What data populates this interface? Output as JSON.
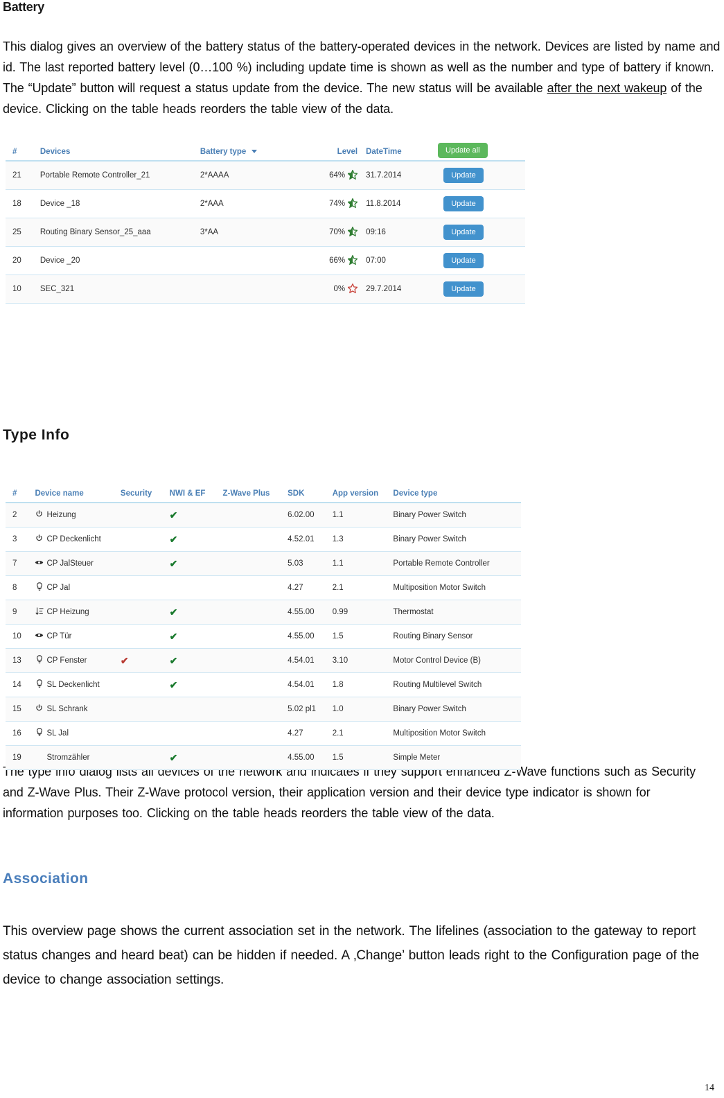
{
  "document": {
    "page_number": "14"
  },
  "sections": {
    "battery": {
      "heading": "Battery",
      "paragraph_html": "This dialog gives an overview of the battery status of the battery-operated devices in the network. Devices are listed by name and id. The last reported battery level (0…100 %) including update time is shown as well as the number and type of battery if known. The “Update” button will request a status update from the device. The new status will be available <span class=\"u\">after the next wakeup</span> of the device. Clicking on the table heads reorders the table view of the data."
    },
    "type_info": {
      "heading": "Type Info",
      "paragraph": "The type info dialog lists all devices of the network and indicates if they support enhanced Z-Wave functions such as Security and Z-Wave Plus. Their Z-Wave protocol version, their application version and their device type indicator is shown for information purposes too. Clicking on the table heads reorders the table view of the data."
    },
    "association": {
      "heading": "Association",
      "paragraph": "This overview page shows the current association set in the network. The lifelines (association to the gateway to report status changes and heard beat) can be hidden if needed. A ‚Change’ button leads right to the Configuration page of the device to change association settings."
    }
  },
  "battery_table": {
    "update_all_label": "Update all",
    "row_button_label": "Update",
    "columns": [
      "#",
      "Devices",
      "Battery type",
      "Level",
      "DateTime",
      ""
    ],
    "sort_indicator_column": "Battery type",
    "colors": {
      "header_text": "#4a7fb5",
      "primary_button": "#4292cd",
      "success_button": "#5cb85c",
      "star_filled": "#2f7d32",
      "star_empty": "#c9453d"
    },
    "rows": [
      {
        "id": "21",
        "device": "Portable Remote Controller_21",
        "battery_type": "2*AAAA",
        "level": "64%",
        "star": "half-green",
        "datetime": "31.7.2014"
      },
      {
        "id": "18",
        "device": "Device _18",
        "battery_type": "2*AAA",
        "level": "74%",
        "star": "half-green",
        "datetime": "11.8.2014"
      },
      {
        "id": "25",
        "device": "Routing Binary Sensor_25_aaa",
        "battery_type": "3*AA",
        "level": "70%",
        "star": "half-green",
        "datetime": "09:16"
      },
      {
        "id": "20",
        "device": "Device _20",
        "battery_type": "",
        "level": "66%",
        "star": "half-green",
        "datetime": "07:00"
      },
      {
        "id": "10",
        "device": "SEC_321",
        "battery_type": "",
        "level": "0%",
        "star": "empty-red",
        "datetime": "29.7.2014"
      }
    ]
  },
  "typeinfo_table": {
    "columns": [
      "#",
      "Device name",
      "Security",
      "NWI & EF",
      "Z-Wave Plus",
      "SDK",
      "App version",
      "Device type"
    ],
    "rows": [
      {
        "id": "2",
        "icon": "power-icon",
        "name": "Heizung",
        "security": "",
        "nwi_ef": "check",
        "zwave_plus": "",
        "sdk": "6.02.00",
        "app": "1.1",
        "device_type": "Binary Power Switch"
      },
      {
        "id": "3",
        "icon": "power-icon",
        "name": "CP Deckenlicht",
        "security": "",
        "nwi_ef": "check",
        "zwave_plus": "",
        "sdk": "4.52.01",
        "app": "1.3",
        "device_type": "Binary Power Switch"
      },
      {
        "id": "7",
        "icon": "eye-icon",
        "name": "CP JalSteuer",
        "security": "",
        "nwi_ef": "check",
        "zwave_plus": "",
        "sdk": "5.03",
        "app": "1.1",
        "device_type": "Portable Remote Controller"
      },
      {
        "id": "8",
        "icon": "bulb-icon",
        "name": "CP Jal",
        "security": "",
        "nwi_ef": "",
        "zwave_plus": "",
        "sdk": "4.27",
        "app": "2.1",
        "device_type": "Multiposition Motor Switch"
      },
      {
        "id": "9",
        "icon": "level-icon",
        "name": "CP Heizung",
        "security": "",
        "nwi_ef": "check",
        "zwave_plus": "",
        "sdk": "4.55.00",
        "app": "0.99",
        "device_type": "Thermostat"
      },
      {
        "id": "10",
        "icon": "eye-icon",
        "name": "CP Tür",
        "security": "",
        "nwi_ef": "check",
        "zwave_plus": "",
        "sdk": "4.55.00",
        "app": "1.5",
        "device_type": "Routing Binary Sensor"
      },
      {
        "id": "13",
        "icon": "bulb-icon",
        "name": "CP Fenster",
        "security": "check-red",
        "nwi_ef": "check",
        "zwave_plus": "",
        "sdk": "4.54.01",
        "app": "3.10",
        "device_type": "Motor Control Device (B)"
      },
      {
        "id": "14",
        "icon": "bulb-icon",
        "name": "SL Deckenlicht",
        "security": "",
        "nwi_ef": "check",
        "zwave_plus": "",
        "sdk": "4.54.01",
        "app": "1.8",
        "device_type": "Routing Multilevel Switch"
      },
      {
        "id": "15",
        "icon": "power-icon",
        "name": "SL Schrank",
        "security": "",
        "nwi_ef": "",
        "zwave_plus": "",
        "sdk": "5.02 pl1",
        "app": "1.0",
        "device_type": "Binary Power Switch"
      },
      {
        "id": "16",
        "icon": "bulb-icon",
        "name": "SL Jal",
        "security": "",
        "nwi_ef": "",
        "zwave_plus": "",
        "sdk": "4.27",
        "app": "2.1",
        "device_type": "Multiposition Motor Switch"
      },
      {
        "id": "19",
        "icon": "",
        "name": "Stromzähler",
        "security": "",
        "nwi_ef": "check",
        "zwave_plus": "",
        "sdk": "4.55.00",
        "app": "1.5",
        "device_type": "Simple Meter"
      }
    ]
  }
}
